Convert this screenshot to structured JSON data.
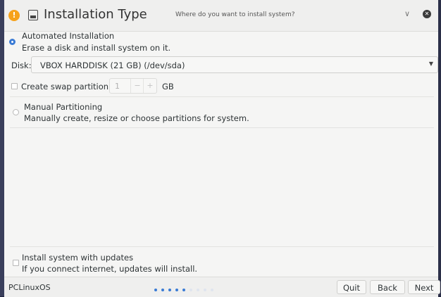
{
  "window": {
    "title": "Installation Type",
    "subtitle": "Where do you want to install system?"
  },
  "automated": {
    "title": "Automated Installation",
    "description": "Erase a disk and install system on it.",
    "selected": true
  },
  "disk": {
    "label": "Disk:",
    "value": "VBOX HARDDISK (21 GB) (/dev/sda)"
  },
  "swap": {
    "label": "Create swap partition",
    "value": "1",
    "minus": "−",
    "plus": "+",
    "unit": "GB",
    "checked": false
  },
  "manual": {
    "title": "Manual Partitioning",
    "description": "Manually create, resize or choose partitions for system.",
    "selected": false
  },
  "updates": {
    "title": "Install system with updates",
    "description": "If you connect internet, updates will install.",
    "checked": false
  },
  "footer": {
    "brand": "PCLinuxOS",
    "progress_total_steps": 9,
    "progress_current_step": 5,
    "quit_label": "Quit",
    "back_label": "Back",
    "next_label": "Next"
  },
  "colors": {
    "accent": "#3a7bd5",
    "warning": "#f6a21b",
    "dot_active": "#3a7bd5",
    "dot_inactive": "#dfe4ee"
  },
  "icons": {
    "warning": "warning-icon",
    "disk": "harddisk-icon",
    "collapse": "chevron-down-icon",
    "close": "close-icon",
    "dropdown": "caret-down-icon"
  }
}
